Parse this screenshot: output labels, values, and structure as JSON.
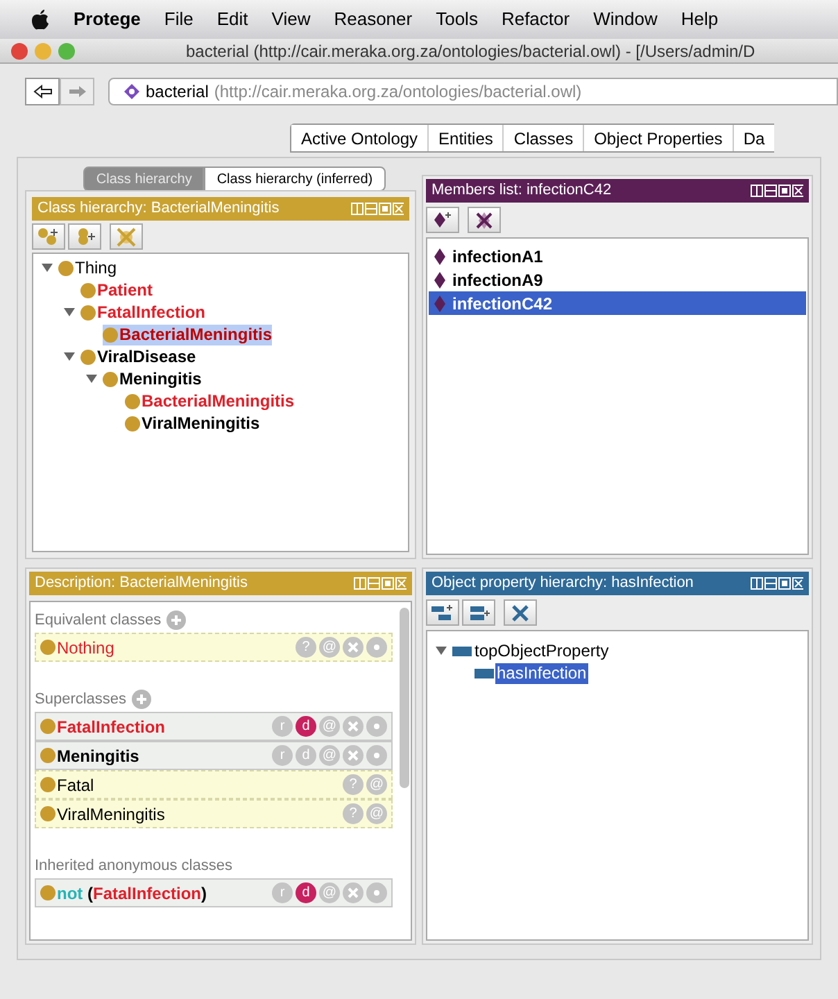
{
  "menu_bar": {
    "app": "Protege",
    "items": [
      "File",
      "Edit",
      "View",
      "Reasoner",
      "Tools",
      "Refactor",
      "Window",
      "Help"
    ]
  },
  "window": {
    "title": "bacterial (http://cair.meraka.org.za/ontologies/bacterial.owl) - [/Users/admin/D"
  },
  "address": {
    "name": "bacterial",
    "iri": "(http://cair.meraka.org.za/ontologies/bacterial.owl)"
  },
  "tabs": [
    {
      "label": "Active Ontology",
      "selected": false
    },
    {
      "label": "Entities",
      "selected": false
    },
    {
      "label": "Classes",
      "selected": false
    },
    {
      "label": "Object Properties",
      "selected": false
    },
    {
      "label": "Da",
      "selected": false
    }
  ],
  "class_panel": {
    "kind": "class",
    "subtabs": [
      {
        "label": "Class hierarchy",
        "selected": true
      },
      {
        "label": "Class hierarchy (inferred)",
        "selected": false
      }
    ],
    "title": "Class hierarchy: BacterialMeningitis",
    "tree": [
      {
        "label": "Thing",
        "unsatisfiable": false,
        "selected": false,
        "expanded": true,
        "children": [
          {
            "label": "Patient",
            "unsatisfiable": true,
            "selected": false
          },
          {
            "label": "FatalInfection",
            "unsatisfiable": true,
            "selected": false,
            "expanded": true,
            "children": [
              {
                "label": "BacterialMeningitis",
                "unsatisfiable": true,
                "selected": true
              }
            ]
          },
          {
            "label": "ViralDisease",
            "unsatisfiable": false,
            "selected": false,
            "expanded": true,
            "children": [
              {
                "label": "Meningitis",
                "unsatisfiable": false,
                "selected": false,
                "expanded": true,
                "children": [
                  {
                    "label": "BacterialMeningitis",
                    "unsatisfiable": true,
                    "selected": false
                  },
                  {
                    "label": "ViralMeningitis",
                    "unsatisfiable": false,
                    "selected": false
                  }
                ]
              }
            ]
          }
        ]
      }
    ]
  },
  "members_panel": {
    "kind": "individual",
    "title": "Members list: infectionC42",
    "items": [
      {
        "label": "infectionA1",
        "selected": false
      },
      {
        "label": "infectionA9",
        "selected": false
      },
      {
        "label": "infectionC42",
        "selected": true
      }
    ]
  },
  "description_panel": {
    "kind": "class",
    "title": "Description: BacterialMeningitis",
    "sections": [
      {
        "label": "Equivalent classes",
        "add": true,
        "rows": [
          {
            "parts": [
              {
                "kind": "class",
                "text": "Nothing"
              }
            ],
            "inferred": true,
            "unsatisfiable": true,
            "badges": [
              {
                "kind": "text",
                "text": "?",
                "active": false
              },
              {
                "kind": "text",
                "text": "@",
                "active": false
              },
              {
                "kind": "delete"
              },
              {
                "kind": "edit"
              }
            ]
          }
        ]
      },
      {
        "label": "Superclasses",
        "add": true,
        "rows": [
          {
            "parts": [
              {
                "kind": "class",
                "text": "FatalInfection"
              }
            ],
            "inferred": false,
            "unsatisfiable": true,
            "badges": [
              {
                "kind": "text",
                "text": "r",
                "active": false
              },
              {
                "kind": "text",
                "text": "d",
                "active": true
              },
              {
                "kind": "text",
                "text": "@",
                "active": false
              },
              {
                "kind": "delete"
              },
              {
                "kind": "edit"
              }
            ]
          },
          {
            "parts": [
              {
                "kind": "class",
                "text": "Meningitis"
              }
            ],
            "inferred": false,
            "unsatisfiable": false,
            "badges": [
              {
                "kind": "text",
                "text": "r",
                "active": false
              },
              {
                "kind": "text",
                "text": "d",
                "active": false
              },
              {
                "kind": "text",
                "text": "@",
                "active": false
              },
              {
                "kind": "delete"
              },
              {
                "kind": "edit"
              }
            ]
          },
          {
            "parts": [
              {
                "kind": "class",
                "text": "Fatal"
              }
            ],
            "inferred": true,
            "unsatisfiable": false,
            "badges": [
              {
                "kind": "text",
                "text": "?",
                "active": false
              },
              {
                "kind": "text",
                "text": "@",
                "active": false
              }
            ]
          },
          {
            "parts": [
              {
                "kind": "class",
                "text": "ViralMeningitis"
              }
            ],
            "inferred": true,
            "unsatisfiable": false,
            "badges": [
              {
                "kind": "text",
                "text": "?",
                "active": false
              },
              {
                "kind": "text",
                "text": "@",
                "active": false
              }
            ]
          }
        ]
      },
      {
        "label": "Inherited anonymous classes",
        "rows": [
          {
            "parts": [
              {
                "kind": "keyword",
                "text": "not"
              },
              {
                "kind": "plain",
                "text": " ("
              },
              {
                "kind": "class",
                "text": "FatalInfection"
              },
              {
                "kind": "plain",
                "text": ")"
              }
            ],
            "inferred": false,
            "unsatisfiable": true,
            "badges": [
              {
                "kind": "text",
                "text": "r",
                "active": false
              },
              {
                "kind": "text",
                "text": "d",
                "active": true
              },
              {
                "kind": "text",
                "text": "@",
                "active": false
              },
              {
                "kind": "delete"
              },
              {
                "kind": "edit"
              }
            ]
          }
        ]
      }
    ]
  },
  "property_panel": {
    "kind": "property",
    "title": "Object property hierarchy: hasInfection",
    "tree": [
      {
        "label": "topObjectProperty",
        "selected": false,
        "expanded": true,
        "children": [
          {
            "label": "hasInfection",
            "selected": true
          }
        ]
      }
    ]
  }
}
